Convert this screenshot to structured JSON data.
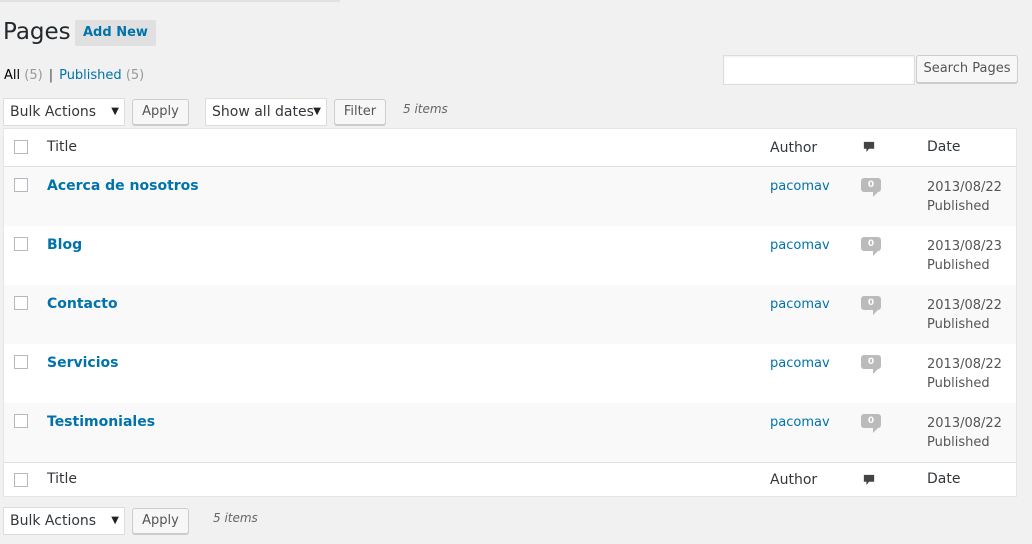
{
  "page": {
    "title": "Pages",
    "add_new": "Add New"
  },
  "views": {
    "all_label": "All",
    "all_count": "(5)",
    "separator": "|",
    "published_label": "Published",
    "published_count": "(5)"
  },
  "search": {
    "placeholder": "",
    "button": "Search Pages"
  },
  "toolbar_top": {
    "bulk_actions": "Bulk Actions",
    "apply": "Apply",
    "dates": "Show all dates",
    "filter": "Filter",
    "items": "5 items"
  },
  "toolbar_bottom": {
    "bulk_actions": "Bulk Actions",
    "apply": "Apply",
    "items": "5 items"
  },
  "columns": {
    "title": "Title",
    "author": "Author",
    "date": "Date"
  },
  "rows": [
    {
      "title": "Acerca de nosotros",
      "author": "pacomav",
      "comments": "0",
      "date": "2013/08/22",
      "status": "Published"
    },
    {
      "title": "Blog",
      "author": "pacomav",
      "comments": "0",
      "date": "2013/08/23",
      "status": "Published"
    },
    {
      "title": "Contacto",
      "author": "pacomav",
      "comments": "0",
      "date": "2013/08/22",
      "status": "Published"
    },
    {
      "title": "Servicios",
      "author": "pacomav",
      "comments": "0",
      "date": "2013/08/22",
      "status": "Published"
    },
    {
      "title": "Testimoniales",
      "author": "pacomav",
      "comments": "0",
      "date": "2013/08/22",
      "status": "Published"
    }
  ],
  "icons": {
    "comments_header": "comment-bubble-icon",
    "dropdown": "chevron-down-icon"
  },
  "colors": {
    "link": "#0073aa",
    "background": "#f1f1f1",
    "bubble": "#bbbbbb"
  }
}
